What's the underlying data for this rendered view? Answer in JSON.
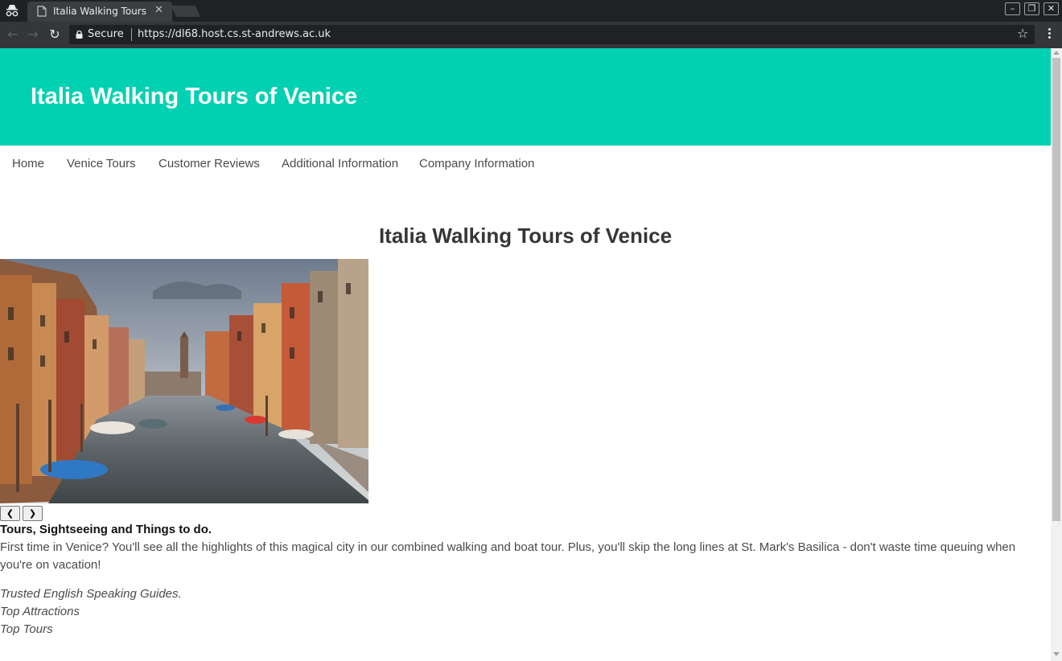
{
  "browser": {
    "tab_title": "Italia Walking Tours of Venice",
    "secure_label": "Secure",
    "url": "https://dl68.host.cs.st-andrews.ac.uk",
    "icons": {
      "incognito": "incognito-icon",
      "tab": "page-icon",
      "close": "close-icon",
      "back": "back-arrow-icon",
      "forward": "forward-arrow-icon",
      "reload": "reload-icon",
      "lock": "lock-icon",
      "bookmark": "star-icon",
      "menu": "kebab-menu-icon"
    },
    "window_controls": [
      "minimize",
      "restore",
      "close"
    ]
  },
  "site": {
    "header_title": "Italia Walking Tours of Venice",
    "header_color": "#00d1b2",
    "nav": [
      {
        "label": "Home"
      },
      {
        "label": "Venice Tours"
      },
      {
        "label": "Customer Reviews"
      },
      {
        "label": "Additional Information"
      },
      {
        "label": "Company Information"
      }
    ]
  },
  "main": {
    "heading": "Italia Walking Tours of Venice",
    "hero_image": "venice-canal-photo",
    "slider": {
      "prev_label": "❮",
      "next_label": "❯"
    },
    "section_title": "Tours, Sightseeing and Things to do.",
    "intro": "First time in Venice? You'll see all the highlights of this magical city in our combined walking and boat tour. Plus, you'll skip the long lines at St. Mark's Basilica - don't waste time queuing when you're on vacation!",
    "features": [
      {
        "text": "Trusted English Speaking Guides."
      },
      {
        "text": "Top Attractions"
      },
      {
        "text": "Top Tours"
      }
    ]
  }
}
